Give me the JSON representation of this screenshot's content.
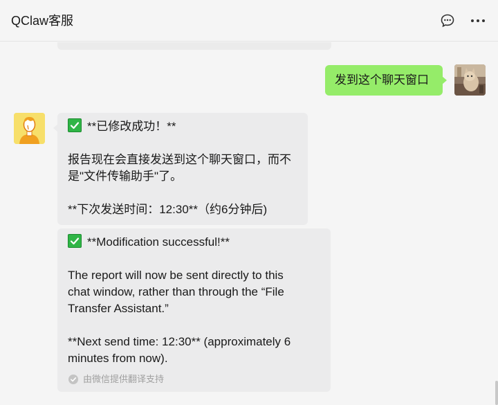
{
  "header": {
    "title": "QClaw客服",
    "chat_icon": "chat-bubble-icon",
    "more_icon": "more-dots-icon"
  },
  "messages": {
    "self": {
      "text": "发到这个聊天窗口",
      "avatar": "cat-photo-avatar"
    },
    "bot_avatar": "cartoon-person-avatar",
    "reply_cn": {
      "check_icon": "green-check-icon",
      "line1": "**已修改成功！**",
      "line2": "报告现在会直接发送到这个聊天窗口，而不",
      "line3": "是\"文件传输助手\"了。",
      "line4": "**下次发送时间：12:30**（约6分钟后)"
    },
    "reply_en": {
      "check_icon": "green-check-icon",
      "line1": "**Modification successful!**",
      "line2": "The report will now be sent directly to this",
      "line3": "chat window, rather than through the  “File",
      "line4": "Transfer Assistant.”",
      "line5": "**Next send time: 12:30** (approximately 6",
      "line6": "minutes from now).",
      "translation_note": "由微信提供翻译支持"
    }
  },
  "colors": {
    "self_bubble": "#95ec69",
    "other_bubble": "#ebebec",
    "background": "#f5f5f5",
    "check_green": "#2fb546"
  }
}
